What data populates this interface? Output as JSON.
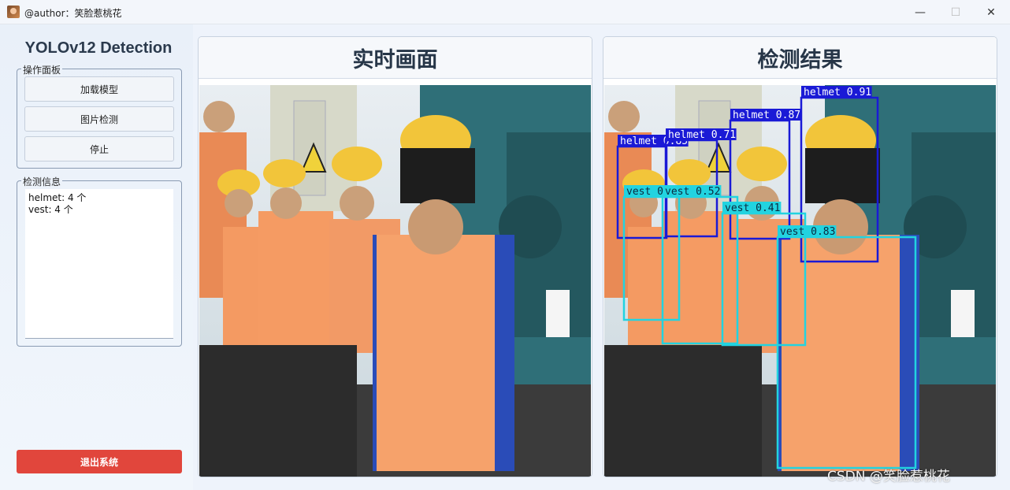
{
  "window": {
    "title": "@author：笑脸惹桃花",
    "minimize_glyph": "—",
    "maximize_glyph": "☐",
    "close_glyph": "✕"
  },
  "sidebar": {
    "app_title": "YOLOv12 Detection",
    "control_group_label": "操作面板",
    "buttons": [
      "加载模型",
      "图片检测",
      "停止"
    ],
    "info_group_label": "检测信息",
    "info_lines": [
      "helmet: 4 个",
      "vest: 4 个"
    ],
    "exit_label": "退出系统"
  },
  "panels": {
    "live_title": "实时画面",
    "result_title": "检测结果"
  },
  "detections": [
    {
      "label": "helmet 0.91",
      "class": "helmet"
    },
    {
      "label": "helmet 0.87",
      "class": "helmet"
    },
    {
      "label": "helmet 0.85",
      "class": "helmet"
    },
    {
      "label": "helmet 0.71",
      "class": "helmet"
    },
    {
      "label": "vest 0.83",
      "class": "vest"
    },
    {
      "label": "vest 0.52",
      "class": "vest"
    },
    {
      "label": "vest 0.41",
      "class": "vest"
    },
    {
      "label": "vest 0",
      "class": "vest"
    }
  ],
  "colors": {
    "helmet_box": "#1a1ad6",
    "vest_box": "#22d3e0",
    "exit_button": "#e1463c"
  },
  "watermark": "CSDN @笑脸惹桃花"
}
